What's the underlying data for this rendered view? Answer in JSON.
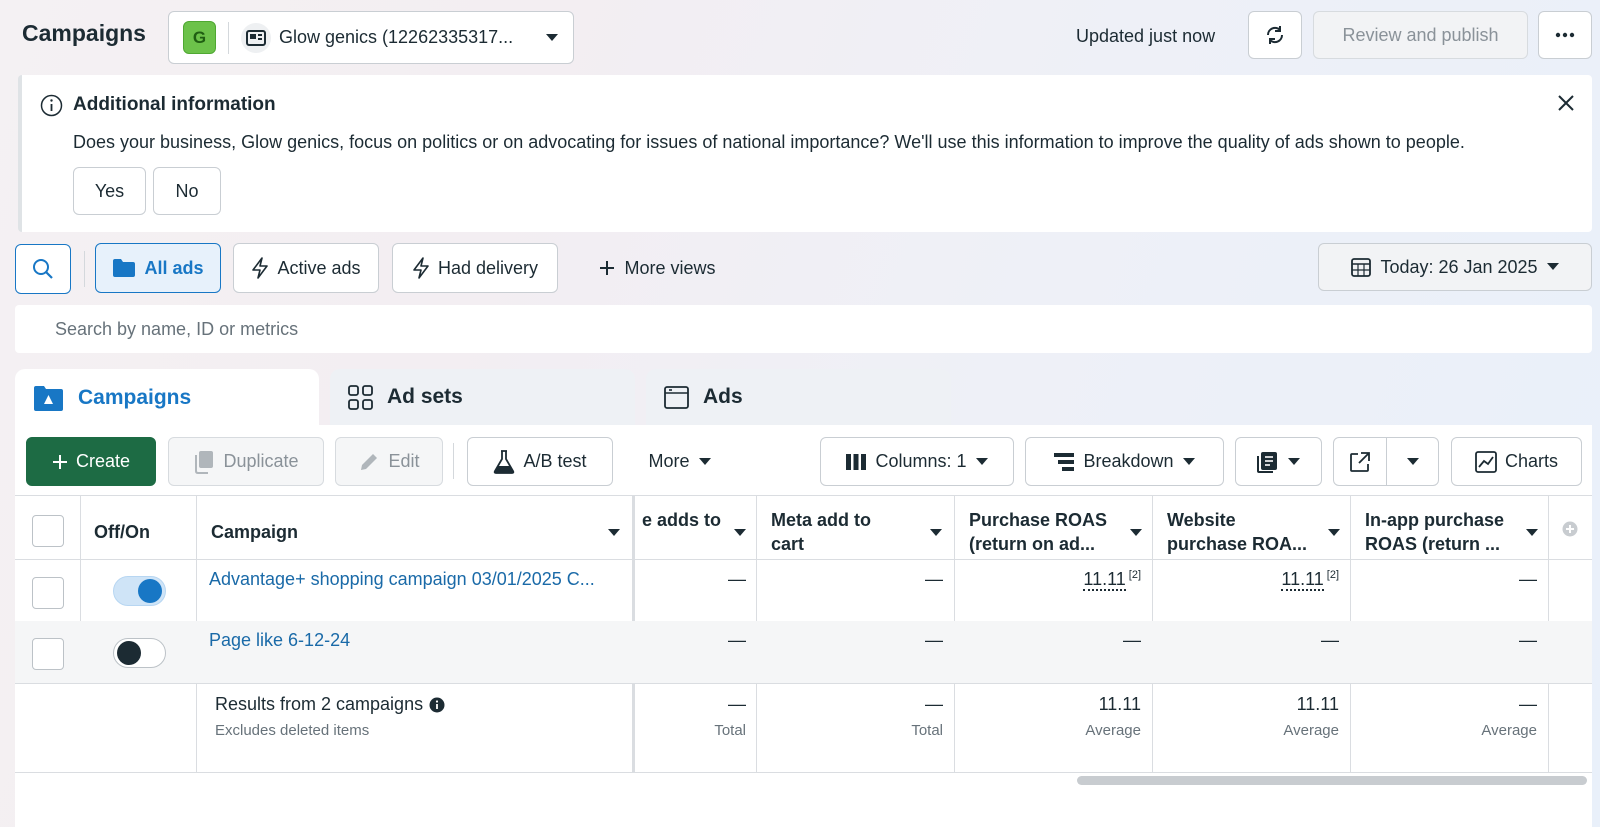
{
  "header": {
    "title": "Campaigns",
    "account": {
      "badge": "G",
      "name": "Glow genics (12262335317..."
    },
    "updated": "Updated just now",
    "review_publish": "Review and publish"
  },
  "banner": {
    "title": "Additional information",
    "text": "Does your business, Glow genics, focus on politics or on advocating for issues of national importance? We'll use this information to improve the quality of ads shown to people.",
    "yes": "Yes",
    "no": "No"
  },
  "filters": {
    "all_ads": "All ads",
    "active_ads": "Active ads",
    "had_delivery": "Had delivery",
    "more_views": "More views",
    "date": "Today: 26 Jan 2025"
  },
  "search": {
    "placeholder": "Search by name, ID or metrics"
  },
  "level_tabs": {
    "campaigns": "Campaigns",
    "ad_sets": "Ad sets",
    "ads": "Ads"
  },
  "toolbar": {
    "create": "Create",
    "duplicate": "Duplicate",
    "edit": "Edit",
    "ab_test": "A/B test",
    "more": "More",
    "columns": "Columns: 1",
    "breakdown": "Breakdown",
    "charts": "Charts"
  },
  "table": {
    "headers": {
      "off_on": "Off/On",
      "campaign": "Campaign",
      "c1": "e adds to",
      "c2a": "Meta add to",
      "c2b": "cart",
      "c3a": "Purchase ROAS",
      "c3b": "(return on ad...",
      "c4a": "Website",
      "c4b": "purchase ROA...",
      "c5a": "In-app purchase",
      "c5b": "ROAS (return ..."
    },
    "rows": [
      {
        "name": "Advantage+ shopping campaign 03/01/2025 C...",
        "on": true,
        "c1": "—",
        "c2": "—",
        "c3": "11.11",
        "c3_note": "[2]",
        "c4": "11.11",
        "c4_note": "[2]",
        "c5": "—"
      },
      {
        "name": "Page like 6-12-24",
        "on": false,
        "c1": "—",
        "c2": "—",
        "c3": "—",
        "c4": "—",
        "c5": "—"
      }
    ],
    "summary": {
      "title": "Results from 2 campaigns",
      "subtitle": "Excludes deleted items",
      "c1": "—",
      "c1_sub": "Total",
      "c2": "—",
      "c2_sub": "Total",
      "c3": "11.11",
      "c3_sub": "Average",
      "c4": "11.11",
      "c4_sub": "Average",
      "c5": "—",
      "c5_sub": "Average"
    }
  }
}
